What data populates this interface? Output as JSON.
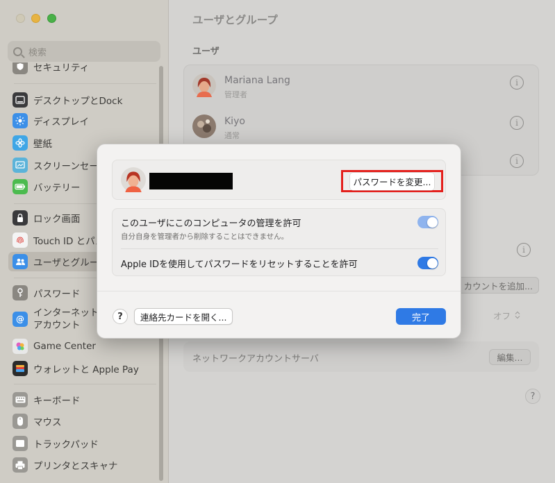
{
  "window": {
    "title": "ユーザとグループ"
  },
  "colors": {
    "accent": "#2f7ae5",
    "highlight_box": "#e4201c",
    "toggle_muted": "#8fb4ee"
  },
  "sidebar": {
    "search_placeholder": "検索",
    "items": [
      {
        "label": "セキュリティ",
        "icon": "shield-icon",
        "color": "#8a8781"
      },
      {
        "label": "デスクトップとDock",
        "icon": "dock-icon",
        "color": "#3a3a3c"
      },
      {
        "label": "ディスプレイ",
        "icon": "sun-icon",
        "color": "#3b8fe8"
      },
      {
        "label": "壁紙",
        "icon": "flower-icon",
        "color": "#3fa6e6"
      },
      {
        "label": "スクリーンセーバ",
        "icon": "screensaver-icon",
        "color": "#5bb3d9"
      },
      {
        "label": "バッテリー",
        "icon": "battery-icon",
        "color": "#4cbb4f"
      },
      {
        "label": "ロック画面",
        "icon": "lock-icon",
        "color": "#3a3a3c"
      },
      {
        "label": "Touch ID とパスコード",
        "icon": "fingerprint-icon",
        "color": "#f4f4f4"
      },
      {
        "label": "ユーザとグループ",
        "icon": "users-icon",
        "color": "#3b8fe8"
      },
      {
        "label": "パスワード",
        "icon": "key-icon",
        "color": "#8a8781"
      },
      {
        "label": "インターネット",
        "label2": "アカウント",
        "icon": "at-icon",
        "color": "#3b8fe8"
      },
      {
        "label": "Game Center",
        "icon": "game-center-icon",
        "color": "#e8e8e8"
      },
      {
        "label": "ウォレットと Apple Pay",
        "icon": "wallet-icon",
        "color": "#2b2b2b"
      },
      {
        "label": "キーボード",
        "icon": "keyboard-icon",
        "color": "#9a9893"
      },
      {
        "label": "マウス",
        "icon": "mouse-icon",
        "color": "#9a9893"
      },
      {
        "label": "トラックパッド",
        "icon": "trackpad-icon",
        "color": "#9a9893"
      },
      {
        "label": "プリンタとスキャナ",
        "icon": "printer-icon",
        "color": "#9a9893"
      }
    ]
  },
  "main": {
    "users_heading": "ユーザ",
    "users": [
      {
        "name": "Mariana Lang",
        "role": "管理者"
      },
      {
        "name": "Kiyo",
        "role": "通常"
      }
    ],
    "add_account_label": "カウントを追加...",
    "off_label": "オフ",
    "network_account_server_label": "ネットワークアカウントサーバ",
    "edit_label": "編集...",
    "help_label": "?"
  },
  "dialog": {
    "change_password_label": "パスワードを変更...",
    "admin_option": {
      "label": "このユーザにこのコンピュータの管理を許可",
      "sublabel": "自分自身を管理者から削除することはできません。",
      "enabled": true
    },
    "appleid_option": {
      "label": "Apple IDを使用してパスワードをリセットすることを許可",
      "enabled": true
    },
    "help_label": "?",
    "contact_card_label": "連絡先カードを開く...",
    "done_label": "完了"
  }
}
